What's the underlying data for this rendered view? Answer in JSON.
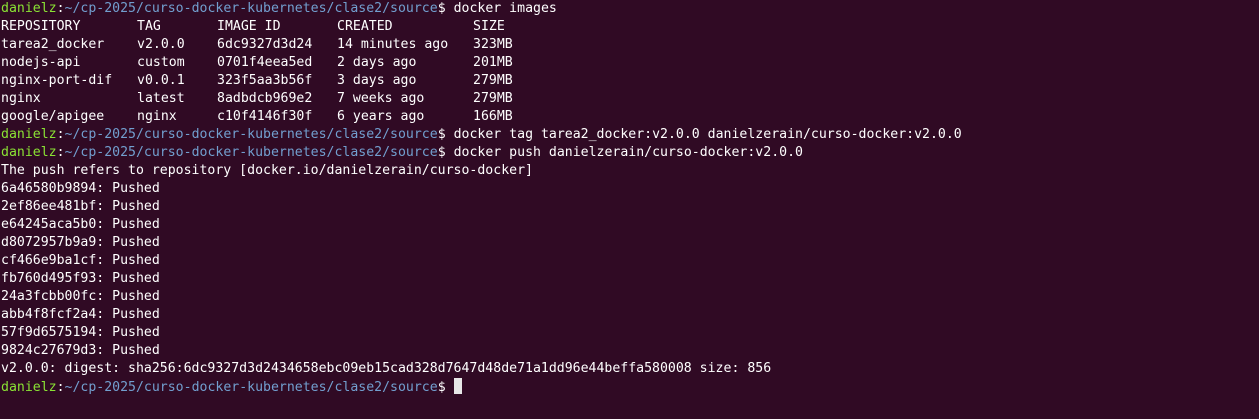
{
  "prompt": {
    "user": "danielz",
    "path": "~/cp-2025/curso-docker-kubernetes/clase2/source",
    "symbol": "$"
  },
  "commands": {
    "images": "docker images",
    "tag": "docker tag tarea2_docker:v2.0.0 danielzerain/curso-docker:v2.0.0",
    "push": "docker push danielzerain/curso-docker:v2.0.0"
  },
  "images_table": {
    "headers": [
      "REPOSITORY",
      "TAG",
      "IMAGE ID",
      "CREATED",
      "SIZE"
    ],
    "rows": [
      [
        "tarea2_docker",
        "v2.0.0",
        "6dc9327d3d24",
        "14 minutes ago",
        "323MB"
      ],
      [
        "nodejs-api",
        "custom",
        "0701f4eea5ed",
        "2 days ago",
        "201MB"
      ],
      [
        "nginx-port-dif",
        "v0.0.1",
        "323f5aa3b56f",
        "3 days ago",
        "279MB"
      ],
      [
        "nginx",
        "latest",
        "8adbdcb969e2",
        "7 weeks ago",
        "279MB"
      ],
      [
        "google/apigee",
        "nginx",
        "c10f4146f30f",
        "6 years ago",
        "166MB"
      ]
    ]
  },
  "push_output": {
    "refers": "The push refers to repository [docker.io/danielzerain/curso-docker]",
    "layers": [
      "6a46580b9894: Pushed",
      "2ef86ee481bf: Pushed",
      "e64245aca5b0: Pushed",
      "d8072957b9a9: Pushed",
      "cf466e9ba1cf: Pushed",
      "fb760d495f93: Pushed",
      "24a3fcbb00fc: Pushed",
      "abb4f8fcf2a4: Pushed",
      "57f9d6575194: Pushed",
      "9824c27679d3: Pushed"
    ],
    "digest": "v2.0.0: digest: sha256:6dc9327d3d2434658ebc09eb15cad328d7647d48de71a1dd96e44beffa580008 size: 856"
  },
  "colors": {
    "background": "#300a24",
    "user": "#8ae234",
    "path": "#729fcf",
    "text": "#ffffff",
    "cursor": "#e7e7e7"
  }
}
